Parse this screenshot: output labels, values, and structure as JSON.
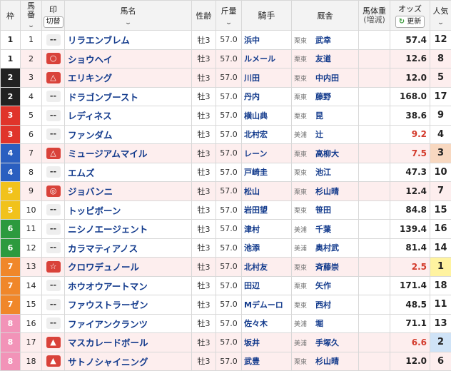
{
  "header": {
    "waku": "枠",
    "umaban_1": "馬",
    "umaban_2": "番",
    "mark": "印",
    "mark_button": "切替",
    "horse": "馬名",
    "sexage": "性齢",
    "weight": "斤量",
    "jockey": "騎手",
    "trainer": "厩舎",
    "bodyweight_1": "馬体重",
    "bodyweight_2": "(増減)",
    "odds": "オッズ",
    "update_button": "更新",
    "update_icon": "refresh-icon",
    "popularity": "人気",
    "sort_icon": "chevron-down-icon"
  },
  "colors": {
    "waku": {
      "1": "#ffffff",
      "2": "#222222",
      "3": "#e0342b",
      "4": "#2a5fc0",
      "5": "#f1c21b",
      "6": "#2c9a3e",
      "7": "#f0872a",
      "8": "#f293b8"
    },
    "hot_odds": "#d33a2b",
    "link": "#123a8c"
  },
  "rows": [
    {
      "waku": "1",
      "num": "1",
      "mark": "--",
      "name": "リラエンブレム",
      "sexage": "牡3",
      "kinryo": "57.0",
      "jockey": "浜中",
      "loc": "栗東",
      "trainer": "武幸",
      "weight": "",
      "odds": "57.4",
      "pop": "12"
    },
    {
      "waku": "1",
      "num": "2",
      "mark": "○",
      "name": "ショウヘイ",
      "sexage": "牡3",
      "kinryo": "57.0",
      "jockey": "ルメール",
      "loc": "栗東",
      "trainer": "友道",
      "weight": "",
      "odds": "12.6",
      "pop": "8"
    },
    {
      "waku": "2",
      "num": "3",
      "mark": "△",
      "name": "エリキング",
      "sexage": "牡3",
      "kinryo": "57.0",
      "jockey": "川田",
      "loc": "栗東",
      "trainer": "中内田",
      "weight": "",
      "odds": "12.0",
      "pop": "5"
    },
    {
      "waku": "2",
      "num": "4",
      "mark": "--",
      "name": "ドラゴンブースト",
      "sexage": "牡3",
      "kinryo": "57.0",
      "jockey": "丹内",
      "loc": "栗東",
      "trainer": "藤野",
      "weight": "",
      "odds": "168.0",
      "pop": "17"
    },
    {
      "waku": "3",
      "num": "5",
      "mark": "--",
      "name": "レディネス",
      "sexage": "牡3",
      "kinryo": "57.0",
      "jockey": "横山典",
      "loc": "栗東",
      "trainer": "昆",
      "weight": "",
      "odds": "38.6",
      "pop": "9"
    },
    {
      "waku": "3",
      "num": "6",
      "mark": "--",
      "name": "ファンダム",
      "sexage": "牡3",
      "kinryo": "57.0",
      "jockey": "北村宏",
      "loc": "美浦",
      "trainer": "辻",
      "weight": "",
      "odds": "9.2",
      "pop": "4"
    },
    {
      "waku": "4",
      "num": "7",
      "mark": "△",
      "name": "ミュージアムマイル",
      "sexage": "牡3",
      "kinryo": "57.0",
      "jockey": "レーン",
      "loc": "栗東",
      "trainer": "高柳大",
      "weight": "",
      "odds": "7.5",
      "pop": "3"
    },
    {
      "waku": "4",
      "num": "8",
      "mark": "--",
      "name": "エムズ",
      "sexage": "牡3",
      "kinryo": "57.0",
      "jockey": "戸崎圭",
      "loc": "栗東",
      "trainer": "池江",
      "weight": "",
      "odds": "47.3",
      "pop": "10"
    },
    {
      "waku": "5",
      "num": "9",
      "mark": "◎",
      "name": "ジョバンニ",
      "sexage": "牡3",
      "kinryo": "57.0",
      "jockey": "松山",
      "loc": "栗東",
      "trainer": "杉山晴",
      "weight": "",
      "odds": "12.4",
      "pop": "7"
    },
    {
      "waku": "5",
      "num": "10",
      "mark": "--",
      "name": "トッピボーン",
      "sexage": "牡3",
      "kinryo": "57.0",
      "jockey": "岩田望",
      "loc": "栗東",
      "trainer": "笹田",
      "weight": "",
      "odds": "84.8",
      "pop": "15"
    },
    {
      "waku": "6",
      "num": "11",
      "mark": "--",
      "name": "ニシノエージェント",
      "sexage": "牡3",
      "kinryo": "57.0",
      "jockey": "津村",
      "loc": "美浦",
      "trainer": "千葉",
      "weight": "",
      "odds": "139.4",
      "pop": "16"
    },
    {
      "waku": "6",
      "num": "12",
      "mark": "--",
      "name": "カラマティアノス",
      "sexage": "牡3",
      "kinryo": "57.0",
      "jockey": "池添",
      "loc": "美浦",
      "trainer": "奥村武",
      "weight": "",
      "odds": "81.4",
      "pop": "14"
    },
    {
      "waku": "7",
      "num": "13",
      "mark": "☆",
      "name": "クロワデュノール",
      "sexage": "牡3",
      "kinryo": "57.0",
      "jockey": "北村友",
      "loc": "栗東",
      "trainer": "斉藤崇",
      "weight": "",
      "odds": "2.5",
      "pop": "1"
    },
    {
      "waku": "7",
      "num": "14",
      "mark": "--",
      "name": "ホウオウアートマン",
      "sexage": "牡3",
      "kinryo": "57.0",
      "jockey": "田辺",
      "loc": "栗東",
      "trainer": "矢作",
      "weight": "",
      "odds": "171.4",
      "pop": "18"
    },
    {
      "waku": "7",
      "num": "15",
      "mark": "--",
      "name": "ファウストラーゼン",
      "sexage": "牡3",
      "kinryo": "57.0",
      "jockey": "Mデムーロ",
      "loc": "栗東",
      "trainer": "西村",
      "weight": "",
      "odds": "48.5",
      "pop": "11"
    },
    {
      "waku": "8",
      "num": "16",
      "mark": "--",
      "name": "ファイアンクランツ",
      "sexage": "牡3",
      "kinryo": "57.0",
      "jockey": "佐々木",
      "loc": "美浦",
      "trainer": "堀",
      "weight": "",
      "odds": "71.1",
      "pop": "13"
    },
    {
      "waku": "8",
      "num": "17",
      "mark": "▲",
      "name": "マスカレードボール",
      "sexage": "牡3",
      "kinryo": "57.0",
      "jockey": "坂井",
      "loc": "美浦",
      "trainer": "手塚久",
      "weight": "",
      "odds": "6.6",
      "pop": "2"
    },
    {
      "waku": "8",
      "num": "18",
      "mark": "▲",
      "name": "サトノシャイニング",
      "sexage": "牡3",
      "kinryo": "57.0",
      "jockey": "武豊",
      "loc": "栗東",
      "trainer": "杉山晴",
      "weight": "",
      "odds": "12.0",
      "pop": "6"
    }
  ]
}
